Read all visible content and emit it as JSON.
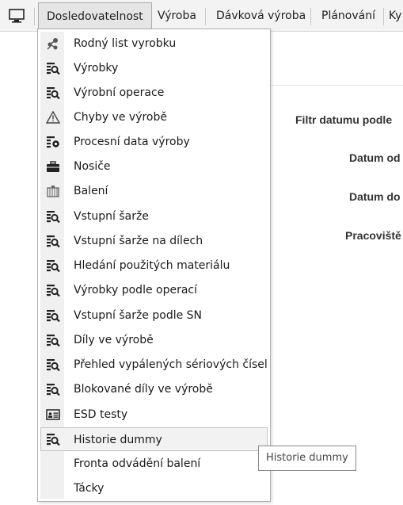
{
  "menubar": {
    "tabs": [
      {
        "label": "Dosledovatelnost"
      },
      {
        "label": "Výroba"
      },
      {
        "label": "Dávková výroba"
      },
      {
        "label": "Plánování"
      },
      {
        "label": "Ky"
      }
    ]
  },
  "filter": {
    "title": "Filtr datumu podle",
    "date_from": "Datum od",
    "date_to": "Datum do",
    "workplace": "Pracoviště"
  },
  "dropdown": {
    "items": [
      {
        "label": "Rodný list vyrobku",
        "icon": "sitemap-icon"
      },
      {
        "label": "Výrobky",
        "icon": "list-search-icon"
      },
      {
        "label": "Výrobní operace",
        "icon": "list-search-icon"
      },
      {
        "label": "Chyby ve výrobě",
        "icon": "warning-icon"
      },
      {
        "label": "Procesní data výroby",
        "icon": "list-gear-icon"
      },
      {
        "label": "Nosiče",
        "icon": "toolbox-icon"
      },
      {
        "label": "Balení",
        "icon": "crate-icon"
      },
      {
        "label": "Vstupní šarže",
        "icon": "list-search-icon"
      },
      {
        "label": "Vstupní šarže na dílech",
        "icon": "list-search-icon"
      },
      {
        "label": "Hledání použitých materiálu",
        "icon": "list-search-icon"
      },
      {
        "label": "Výrobky podle operací",
        "icon": "list-search-icon"
      },
      {
        "label": "Vstupní šarže podle SN",
        "icon": "list-search-icon"
      },
      {
        "label": "Díly ve výrobě",
        "icon": "list-search-icon"
      },
      {
        "label": "Přehled vypálených sériových čísel",
        "icon": "list-search-icon"
      },
      {
        "label": "Blokované díly ve výrobě",
        "icon": "list-search-icon"
      },
      {
        "label": "ESD testy",
        "icon": "id-card-icon"
      },
      {
        "label": "Historie dummy",
        "icon": "list-search-icon"
      },
      {
        "label": "Fronta odvádění balení",
        "icon": ""
      },
      {
        "label": "Tácky",
        "icon": ""
      }
    ],
    "hovered_index": 16
  },
  "tooltip": {
    "text": "Historie dummy"
  }
}
